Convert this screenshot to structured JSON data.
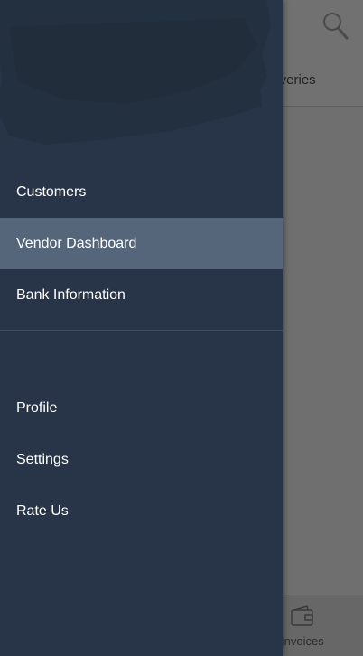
{
  "background": {
    "tab_label": "liveries",
    "bottom_tab_label": "Invoices"
  },
  "drawer": {
    "primary_items": [
      {
        "label": "Customers",
        "active": false
      },
      {
        "label": "Vendor Dashboard",
        "active": true
      },
      {
        "label": "Bank Information",
        "active": false
      }
    ],
    "secondary_items": [
      {
        "label": "Profile"
      },
      {
        "label": "Settings"
      },
      {
        "label": "Rate Us"
      }
    ]
  },
  "colors": {
    "drawer_bg": "#283548",
    "active_item_bg": "#56667a",
    "overlay": "#6f6f6f"
  },
  "icons": [
    "search-icon",
    "wallet-icon"
  ]
}
